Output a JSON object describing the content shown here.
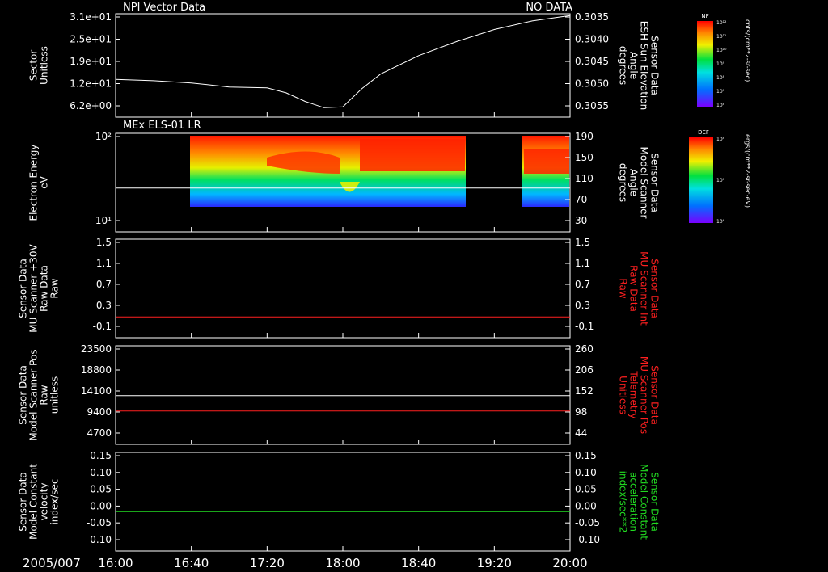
{
  "colors": {
    "white": "#ffffff",
    "red": "#ff2020",
    "green": "#22dd22",
    "background": "#000000"
  },
  "time_axis": {
    "date_label": "2005/007",
    "ticks": [
      "16:00",
      "16:40",
      "17:20",
      "18:00",
      "18:40",
      "19:20",
      "20:00"
    ]
  },
  "chart_data": [
    {
      "type": "line",
      "title": "NPI Vector Data",
      "status": "NO DATA",
      "left_axis": {
        "label_lines": [
          "Sector",
          "Unitless"
        ],
        "ticks": [
          "3.1e+01",
          "2.5e+01",
          "1.9e+01",
          "1.2e+01",
          "6.2e+00"
        ]
      },
      "right_axis": {
        "label_lines": [
          "Sensor Data",
          "ESH Sun Elevation",
          "Angle",
          "degrees"
        ],
        "ticks": [
          "0.3035",
          "0.3040",
          "0.3045",
          "0.3050",
          "0.3055"
        ],
        "ylim": [
          -0.3058,
          -0.3035
        ]
      },
      "series": [
        {
          "color": "white",
          "x": [
            "16:00",
            "16:20",
            "16:40",
            "17:00",
            "17:10",
            "17:20",
            "17:30",
            "17:40",
            "17:50",
            "18:00",
            "18:10",
            "18:20",
            "18:40",
            "19:00",
            "19:20",
            "19:40",
            "20:00"
          ],
          "y": [
            -0.30496,
            -0.30499,
            -0.30504,
            -0.30513,
            -0.30514,
            -0.30515,
            -0.30526,
            -0.30545,
            -0.30559,
            -0.30557,
            -0.30517,
            -0.30484,
            -0.30443,
            -0.30412,
            -0.30385,
            -0.30366,
            -0.30354
          ]
        }
      ],
      "colorbar": {
        "label": "NF",
        "units": "cnts/(cm**2-sr-sec)",
        "ticks": [
          "10¹²",
          "10¹¹",
          "10¹⁰",
          "10⁹",
          "10⁸",
          "10⁷",
          "10⁶"
        ]
      }
    },
    {
      "type": "heatmap",
      "title": "MEx ELS-01 LR",
      "left_axis": {
        "label_lines": [
          "Electron Energy",
          "eV"
        ],
        "ticks": [
          "10²",
          "10¹"
        ]
      },
      "right_axis": {
        "label_lines": [
          "Sensor Data",
          "Model Scanner",
          "Angle",
          "degrees"
        ],
        "ticks": [
          "190",
          "150",
          "110",
          "70",
          "30"
        ],
        "ylim": [
          10,
          190
        ]
      },
      "data_intervals": [
        [
          "16:40",
          "19:00"
        ],
        [
          "19:35",
          "20:00"
        ]
      ],
      "series": [
        {
          "color": "white",
          "x": [
            "16:00",
            "20:00"
          ],
          "y": [
            90,
            90
          ]
        }
      ],
      "colorbar": {
        "label": "DEF",
        "units": "ergs/(cm**2-sr-sec-eV)",
        "ticks": [
          "10⁸",
          "10⁷",
          "10⁶"
        ]
      }
    },
    {
      "type": "line",
      "left_axis": {
        "label_lines": [
          "Sensor Data",
          "MU Scanner +30V",
          "Raw Data",
          "Raw"
        ],
        "ticks": [
          "1.5",
          "1.1",
          "0.7",
          "0.3",
          "-0.1"
        ],
        "ylim": [
          -0.4,
          1.5
        ]
      },
      "right_axis": {
        "label_lines": [
          "Sensor Data",
          "MU Scanner Int",
          "Raw Data",
          "Raw"
        ],
        "label_color": "red",
        "ticks": [
          "1.5",
          "1.1",
          "0.7",
          "0.3",
          "-0.1"
        ],
        "ylim": [
          -0.4,
          1.5
        ]
      },
      "series": [
        {
          "color": "red",
          "x": [
            "16:00",
            "20:00"
          ],
          "y": [
            0,
            0
          ]
        }
      ]
    },
    {
      "type": "line",
      "left_axis": {
        "label_lines": [
          "Sensor Data",
          "Model Scanner Pos",
          "Raw",
          "unitless"
        ],
        "ticks": [
          "23500",
          "18800",
          "14100",
          "9400",
          "4700"
        ],
        "ylim": [
          0,
          23500
        ]
      },
      "right_axis": {
        "label_lines": [
          "Sensor Data",
          "MU Scanner Pos",
          "Telemetry",
          "Unitless"
        ],
        "label_color": "red",
        "ticks": [
          "260",
          "206",
          "152",
          "98",
          "44"
        ],
        "ylim": [
          0,
          260
        ]
      },
      "series": [
        {
          "color": "white",
          "x": [
            "16:00",
            "20:00"
          ],
          "y": [
            11600,
            11600
          ]
        },
        {
          "color": "red",
          "x": [
            "16:00",
            "20:00"
          ],
          "y": [
            88,
            88
          ]
        }
      ]
    },
    {
      "type": "line",
      "left_axis": {
        "label_lines": [
          "Sensor Data",
          "Model Constant",
          "velocity",
          "index/sec"
        ],
        "ticks": [
          "0.15",
          "0.10",
          "0.05",
          "0.00",
          "-0.05",
          "-0.10"
        ],
        "ylim": [
          -0.1,
          0.15
        ]
      },
      "right_axis": {
        "label_lines": [
          "Sensor Data",
          "Model Constant",
          "acceleration",
          "index/sec**2"
        ],
        "label_color": "green",
        "ticks": [
          "0.15",
          "0.10",
          "0.05",
          "0.00",
          "-0.05",
          "-0.10"
        ],
        "ylim": [
          -0.1,
          0.15
        ]
      },
      "series": [
        {
          "color": "green",
          "x": [
            "16:00",
            "20:00"
          ],
          "y": [
            0,
            0
          ]
        }
      ]
    }
  ]
}
